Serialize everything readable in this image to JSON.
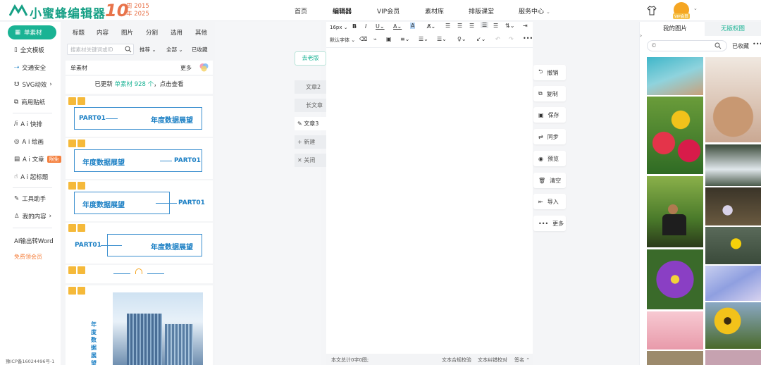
{
  "header": {
    "logo_text": "小蜜蜂编辑器",
    "anniv_num": "10",
    "anniv_year1": "周 2015",
    "anniv_year2": "年 2025",
    "nav": [
      "首页",
      "编辑器",
      "VIP会员",
      "素材库",
      "排版课堂",
      "服务中心"
    ],
    "avatar_badge": "VIP会员"
  },
  "sidebar": {
    "items": [
      "单素材",
      "全文模板",
      "交通安全",
      "SVG动效",
      "商用贴纸",
      "A i 快排",
      "A i 绘画",
      "A i 文章",
      "A i 起标题",
      "工具助手",
      "我的内容",
      "AI输出转Word",
      "免费领会员"
    ],
    "free_badge": "限免",
    "icp": "豫ICP备16024496号-1"
  },
  "materials": {
    "tabs": [
      "标题",
      "内容",
      "图片",
      "分割",
      "选用",
      "其他"
    ],
    "search_placeholder": "搜素材关键词或ID",
    "filters": [
      "推荐",
      "全部",
      "已收藏"
    ],
    "section_label": "单素材",
    "more": "更多",
    "updated_prefix": "已更新",
    "updated_highlight": "单素材 928 个",
    "updated_suffix": "，点击查看",
    "card_title": "年度数据展望",
    "card_part": "PART01",
    "vertical_title": "年度数据展望"
  },
  "doc": {
    "version_btn": "去老版",
    "tabs": [
      "文章2",
      "长文章",
      "文章3",
      "新建",
      "关闭"
    ]
  },
  "editor": {
    "font_size": "16px",
    "font_family": "默认字体",
    "footer_count": "本文总计0字0图;",
    "footer_check1": "文本合规校验",
    "footer_check2": "文本纠错校对",
    "footer_sign": "签名"
  },
  "actions": [
    "撤销",
    "复制",
    "保存",
    "同步",
    "预览",
    "清空",
    "导入",
    "更多"
  ],
  "images": {
    "tabs": [
      "我的图片",
      "无版权图"
    ],
    "fav": "已收藏"
  },
  "colors": {
    "accent": "#1ab394",
    "orange": "#f5813f",
    "blue": "#1b7fc4"
  }
}
